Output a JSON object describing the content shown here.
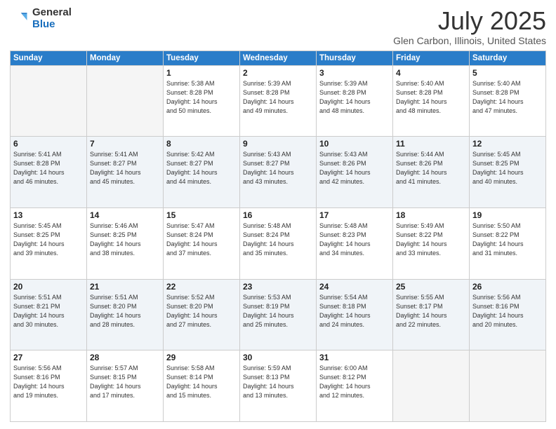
{
  "header": {
    "logo_general": "General",
    "logo_blue": "Blue",
    "month": "July 2025",
    "location": "Glen Carbon, Illinois, United States"
  },
  "days_of_week": [
    "Sunday",
    "Monday",
    "Tuesday",
    "Wednesday",
    "Thursday",
    "Friday",
    "Saturday"
  ],
  "weeks": [
    [
      {
        "day": "",
        "info": ""
      },
      {
        "day": "",
        "info": ""
      },
      {
        "day": "1",
        "info": "Sunrise: 5:38 AM\nSunset: 8:28 PM\nDaylight: 14 hours\nand 50 minutes."
      },
      {
        "day": "2",
        "info": "Sunrise: 5:39 AM\nSunset: 8:28 PM\nDaylight: 14 hours\nand 49 minutes."
      },
      {
        "day": "3",
        "info": "Sunrise: 5:39 AM\nSunset: 8:28 PM\nDaylight: 14 hours\nand 48 minutes."
      },
      {
        "day": "4",
        "info": "Sunrise: 5:40 AM\nSunset: 8:28 PM\nDaylight: 14 hours\nand 48 minutes."
      },
      {
        "day": "5",
        "info": "Sunrise: 5:40 AM\nSunset: 8:28 PM\nDaylight: 14 hours\nand 47 minutes."
      }
    ],
    [
      {
        "day": "6",
        "info": "Sunrise: 5:41 AM\nSunset: 8:28 PM\nDaylight: 14 hours\nand 46 minutes."
      },
      {
        "day": "7",
        "info": "Sunrise: 5:41 AM\nSunset: 8:27 PM\nDaylight: 14 hours\nand 45 minutes."
      },
      {
        "day": "8",
        "info": "Sunrise: 5:42 AM\nSunset: 8:27 PM\nDaylight: 14 hours\nand 44 minutes."
      },
      {
        "day": "9",
        "info": "Sunrise: 5:43 AM\nSunset: 8:27 PM\nDaylight: 14 hours\nand 43 minutes."
      },
      {
        "day": "10",
        "info": "Sunrise: 5:43 AM\nSunset: 8:26 PM\nDaylight: 14 hours\nand 42 minutes."
      },
      {
        "day": "11",
        "info": "Sunrise: 5:44 AM\nSunset: 8:26 PM\nDaylight: 14 hours\nand 41 minutes."
      },
      {
        "day": "12",
        "info": "Sunrise: 5:45 AM\nSunset: 8:25 PM\nDaylight: 14 hours\nand 40 minutes."
      }
    ],
    [
      {
        "day": "13",
        "info": "Sunrise: 5:45 AM\nSunset: 8:25 PM\nDaylight: 14 hours\nand 39 minutes."
      },
      {
        "day": "14",
        "info": "Sunrise: 5:46 AM\nSunset: 8:25 PM\nDaylight: 14 hours\nand 38 minutes."
      },
      {
        "day": "15",
        "info": "Sunrise: 5:47 AM\nSunset: 8:24 PM\nDaylight: 14 hours\nand 37 minutes."
      },
      {
        "day": "16",
        "info": "Sunrise: 5:48 AM\nSunset: 8:24 PM\nDaylight: 14 hours\nand 35 minutes."
      },
      {
        "day": "17",
        "info": "Sunrise: 5:48 AM\nSunset: 8:23 PM\nDaylight: 14 hours\nand 34 minutes."
      },
      {
        "day": "18",
        "info": "Sunrise: 5:49 AM\nSunset: 8:22 PM\nDaylight: 14 hours\nand 33 minutes."
      },
      {
        "day": "19",
        "info": "Sunrise: 5:50 AM\nSunset: 8:22 PM\nDaylight: 14 hours\nand 31 minutes."
      }
    ],
    [
      {
        "day": "20",
        "info": "Sunrise: 5:51 AM\nSunset: 8:21 PM\nDaylight: 14 hours\nand 30 minutes."
      },
      {
        "day": "21",
        "info": "Sunrise: 5:51 AM\nSunset: 8:20 PM\nDaylight: 14 hours\nand 28 minutes."
      },
      {
        "day": "22",
        "info": "Sunrise: 5:52 AM\nSunset: 8:20 PM\nDaylight: 14 hours\nand 27 minutes."
      },
      {
        "day": "23",
        "info": "Sunrise: 5:53 AM\nSunset: 8:19 PM\nDaylight: 14 hours\nand 25 minutes."
      },
      {
        "day": "24",
        "info": "Sunrise: 5:54 AM\nSunset: 8:18 PM\nDaylight: 14 hours\nand 24 minutes."
      },
      {
        "day": "25",
        "info": "Sunrise: 5:55 AM\nSunset: 8:17 PM\nDaylight: 14 hours\nand 22 minutes."
      },
      {
        "day": "26",
        "info": "Sunrise: 5:56 AM\nSunset: 8:16 PM\nDaylight: 14 hours\nand 20 minutes."
      }
    ],
    [
      {
        "day": "27",
        "info": "Sunrise: 5:56 AM\nSunset: 8:16 PM\nDaylight: 14 hours\nand 19 minutes."
      },
      {
        "day": "28",
        "info": "Sunrise: 5:57 AM\nSunset: 8:15 PM\nDaylight: 14 hours\nand 17 minutes."
      },
      {
        "day": "29",
        "info": "Sunrise: 5:58 AM\nSunset: 8:14 PM\nDaylight: 14 hours\nand 15 minutes."
      },
      {
        "day": "30",
        "info": "Sunrise: 5:59 AM\nSunset: 8:13 PM\nDaylight: 14 hours\nand 13 minutes."
      },
      {
        "day": "31",
        "info": "Sunrise: 6:00 AM\nSunset: 8:12 PM\nDaylight: 14 hours\nand 12 minutes."
      },
      {
        "day": "",
        "info": ""
      },
      {
        "day": "",
        "info": ""
      }
    ]
  ]
}
